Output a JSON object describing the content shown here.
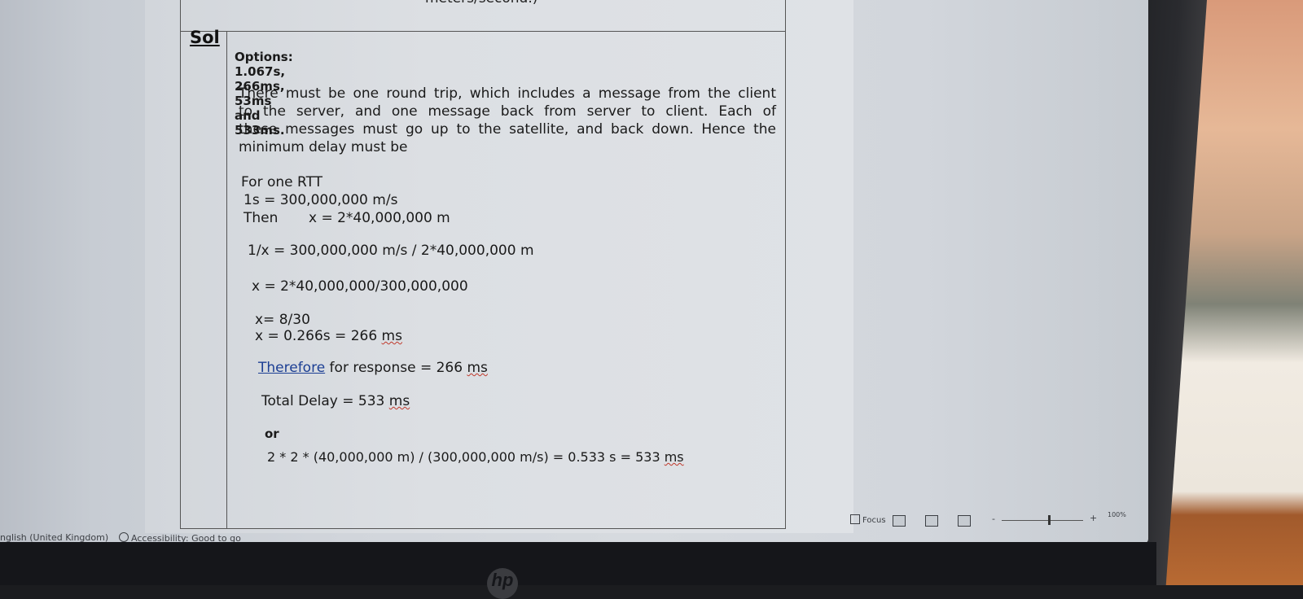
{
  "document": {
    "top_fragment": "meters/second.)",
    "sol_label": "Sol",
    "options": "Options: 1.067s, 266ms, 53ms and 533ms.",
    "paragraph": [
      "There must be one round trip, which includes a message from the client",
      "to the server, and one message back from server to client. Each of",
      "these messages must go up to the satellite, and back down. Hence the",
      "minimum delay must be"
    ],
    "for_one_rtt": "For one RTT",
    "speed_line": "1s = 300,000,000 m/s",
    "then_label": "Then",
    "then_value": "x = 2*40,000,000 m",
    "inverse_line": "1/x = 300,000,000 m/s / 2*40,000,000 m",
    "x_line": "x = 2*40,000,000/300,000,000",
    "x_fraction": "x= 8/30",
    "x_result_prefix": "x = 0.266s = 266 ",
    "unit_ms": "ms",
    "therefore_word": "Therefore",
    "therefore_rest": " for response = 266 ",
    "total_delay_prefix": "Total Delay = 533 ",
    "or_label": "or",
    "formula_prefix": "2 * 2 * (40,000,000 m) / (300,000,000 m/s) = 0.533 s = 533 "
  },
  "statusbar": {
    "language": "nglish (United Kingdom)",
    "accessibility": "Accessibility: Good to go",
    "focus": "Focus",
    "zoom_minus": "-",
    "zoom_plus": "+",
    "zoom_level": "100%"
  }
}
